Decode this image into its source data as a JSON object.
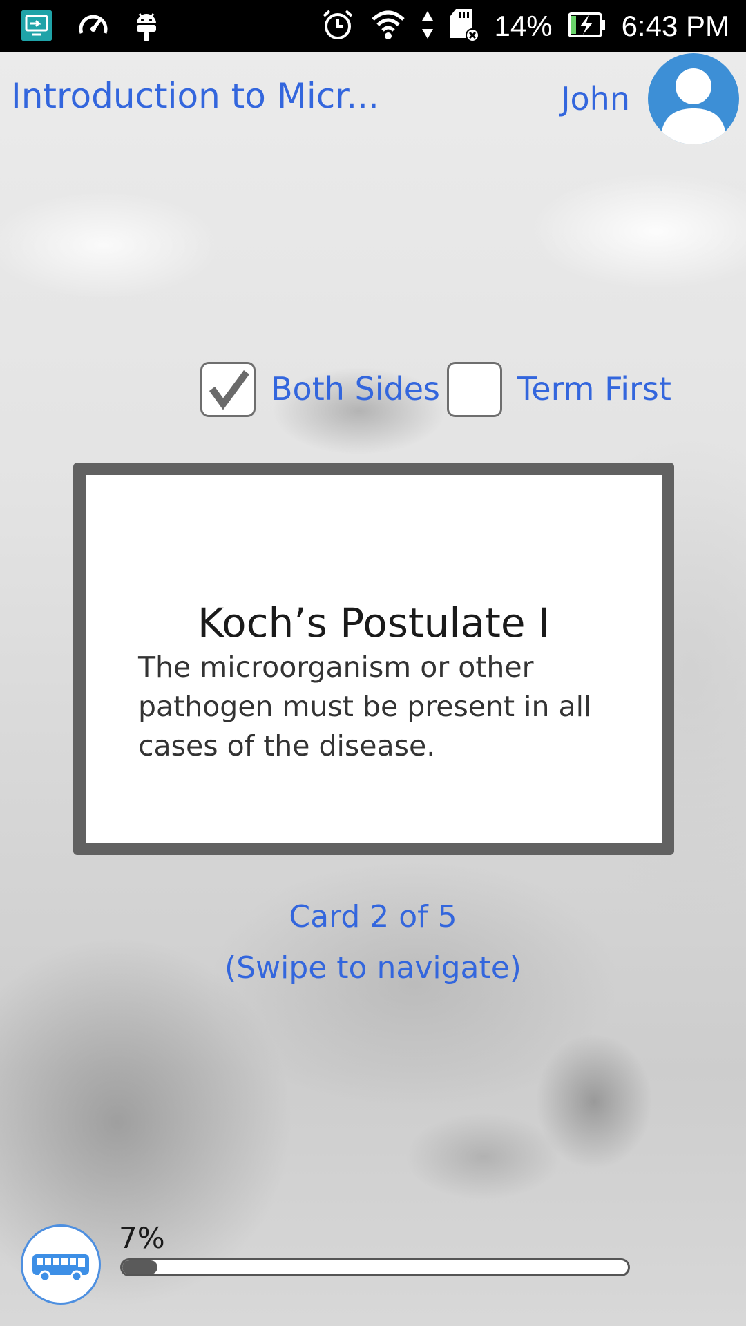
{
  "status_bar": {
    "battery": "14%",
    "time": "6:43 PM",
    "icons": [
      "screen-mirror-icon",
      "speedometer-icon",
      "android-icon",
      "alarm-icon",
      "wifi-icon",
      "data-arrows-icon",
      "sd-card-icon",
      "battery-charging-icon"
    ]
  },
  "header": {
    "title": "Introduction to Micr...",
    "user_name": "John",
    "avatar_icon": "user-avatar-icon"
  },
  "options": {
    "both_sides": {
      "label": "Both Sides",
      "checked": true
    },
    "term_first": {
      "label": "Term First",
      "checked": false
    }
  },
  "card": {
    "term": "Koch’s Postulate I",
    "definition": "The microorganism or other pathogen must be present in all cases of the disease."
  },
  "navigation": {
    "counter": "Card 2 of 5",
    "hint": "(Swipe to navigate)"
  },
  "progress": {
    "label": "7%",
    "value": 0.07
  },
  "bottom": {
    "bus_icon": "bus-icon"
  },
  "colors": {
    "accent": "#3366dd",
    "card_border": "#616161",
    "avatar": "#3d8fd6"
  }
}
